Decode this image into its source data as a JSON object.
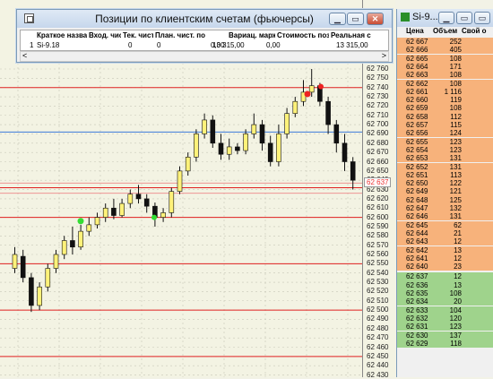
{
  "price_scale": {
    "ticks": [
      "62 760",
      "62 750",
      "62 740",
      "62 730",
      "62 720",
      "62 710",
      "62 700",
      "62 690",
      "62 680",
      "62 670",
      "62 660",
      "62 650",
      "62 640",
      "62 630",
      "62 620",
      "62 610",
      "62 600",
      "62 590",
      "62 580",
      "62 570",
      "62 560",
      "62 550",
      "62 540",
      "62 530",
      "62 520",
      "62 510",
      "62 500",
      "62 490",
      "62 480",
      "62 470",
      "62 460",
      "62 450",
      "62 440",
      "62 430"
    ],
    "current_price": "62 637"
  },
  "positions_window": {
    "title": "Позиции по клиентским счетам (фьючерсы)",
    "columns": [
      "Краткое название",
      "Вход. чист",
      "Тек. чист",
      "План. чист. поз.",
      "Вариац. маржа",
      "Стоимость позиции",
      "Реальная с"
    ],
    "row": [
      "1",
      "Si-9.18",
      "0",
      "0",
      "0,00",
      "13 315,00",
      "0,00",
      "13 315,00"
    ],
    "scroll_left": "<",
    "scroll_right": ">"
  },
  "dom_window": {
    "title": "Si-9...",
    "headers": [
      "Цена",
      "Объем",
      "Свой о"
    ],
    "asks": [
      [
        "62 667",
        "252"
      ],
      [
        "62 666",
        "405"
      ],
      [
        "62 665",
        "108"
      ],
      [
        "62 664",
        "171"
      ],
      [
        "62 663",
        "108"
      ],
      [
        "62 662",
        "108"
      ],
      [
        "62 661",
        "1 116"
      ],
      [
        "62 660",
        "119"
      ],
      [
        "62 659",
        "108"
      ],
      [
        "62 658",
        "112"
      ],
      [
        "62 657",
        "115"
      ],
      [
        "62 656",
        "124"
      ],
      [
        "62 655",
        "123"
      ],
      [
        "62 654",
        "123"
      ],
      [
        "62 653",
        "131"
      ],
      [
        "62 652",
        "131"
      ],
      [
        "62 651",
        "113"
      ],
      [
        "62 650",
        "122"
      ],
      [
        "62 649",
        "121"
      ],
      [
        "62 648",
        "125"
      ],
      [
        "62 647",
        "132"
      ],
      [
        "62 646",
        "131"
      ],
      [
        "62 645",
        "62"
      ],
      [
        "62 644",
        "21"
      ],
      [
        "62 643",
        "12"
      ],
      [
        "62 642",
        "13"
      ],
      [
        "62 641",
        "12"
      ],
      [
        "62 640",
        "23"
      ]
    ],
    "bids": [
      [
        "62 637",
        "12"
      ],
      [
        "62 636",
        "13"
      ],
      [
        "62 635",
        "108"
      ],
      [
        "62 634",
        "20"
      ],
      [
        "62 633",
        "104"
      ],
      [
        "62 632",
        "120"
      ],
      [
        "62 631",
        "123"
      ],
      [
        "62 630",
        "137"
      ],
      [
        "62 629",
        "118"
      ]
    ]
  },
  "colors": {
    "ask": "#f7b27b",
    "bid": "#9fd38c",
    "level_line": "#e02020",
    "blue_line": "#3b78d8",
    "candle_up": "#fff27a",
    "candle_down": "#111111",
    "signal_buy": "#33dd33",
    "signal_sell": "#ee2222"
  }
}
